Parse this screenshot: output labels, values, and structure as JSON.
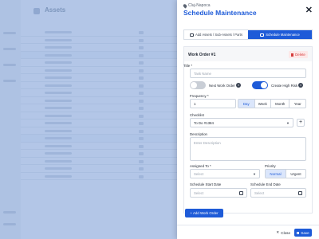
{
  "background": {
    "header": {
      "title": "Assets"
    }
  },
  "drawer": {
    "location": "Cluj-Napoca",
    "title": "Schedule Maintenance",
    "close_symbol": "✕",
    "tabs": [
      {
        "label": "Add Assets / Sub-Assets / Parts",
        "active": false
      },
      {
        "label": "Schedule Maintenance",
        "active": true
      }
    ],
    "work_order": {
      "heading": "Work Order #1",
      "delete_label": "Delete",
      "title_label": "Title *",
      "title_placeholder": "Task Name",
      "next_work_order_label": "Next Work Order",
      "next_work_order_on": false,
      "create_high_risk_label": "Create High Risk",
      "create_high_risk_on": true,
      "info_symbol": "i",
      "frequency_label": "Frequency *",
      "frequency_value": "1",
      "frequency_units": [
        {
          "label": "Day",
          "selected": true
        },
        {
          "label": "Week",
          "selected": false
        },
        {
          "label": "Month",
          "selected": false
        },
        {
          "label": "Year",
          "selected": false
        }
      ],
      "checklist_label": "Checklist",
      "checklist_value": "To Do #1384",
      "plus_symbol": "+",
      "description_label": "Description",
      "description_placeholder": "Enter Description",
      "assigned_to_label": "Assigned To *",
      "assigned_to_placeholder": "Select",
      "priority_label": "Priority",
      "priority_options": [
        {
          "label": "Normal",
          "selected": true
        },
        {
          "label": "Urgent",
          "selected": false
        }
      ],
      "start_date_label": "Schedule Start Date",
      "start_date_placeholder": "Select",
      "end_date_label": "Schedule End Date",
      "end_date_placeholder": "Select"
    },
    "add_work_order_label": "+ Add Work Order",
    "footer": {
      "close_label": "Close",
      "save_label": "Save"
    }
  }
}
